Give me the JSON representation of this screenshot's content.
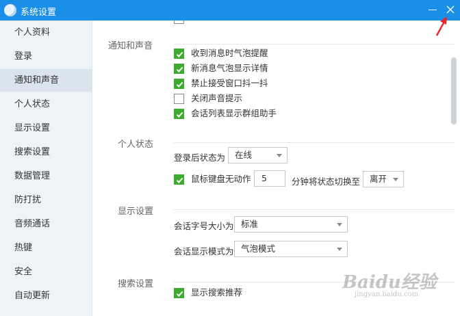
{
  "window": {
    "title": "系统设置"
  },
  "sidebar": {
    "items": [
      {
        "label": "个人资料"
      },
      {
        "label": "登录"
      },
      {
        "label": "通知和声音",
        "active": true
      },
      {
        "label": "个人状态"
      },
      {
        "label": "显示设置"
      },
      {
        "label": "搜索设置"
      },
      {
        "label": "数据管理"
      },
      {
        "label": "防打扰"
      },
      {
        "label": "音频通话"
      },
      {
        "label": "热键"
      },
      {
        "label": "安全"
      },
      {
        "label": "自动更新"
      }
    ]
  },
  "sections": {
    "notify": {
      "title": "通知和声音",
      "options": [
        {
          "label": "收到消息时气泡提醒",
          "checked": true
        },
        {
          "label": "新消息气泡显示详情",
          "checked": true
        },
        {
          "label": "禁止接受窗口抖一抖",
          "checked": true
        },
        {
          "label": "关闭声音提示",
          "checked": false
        },
        {
          "label": "会话列表显示群组助手",
          "checked": true
        }
      ]
    },
    "status": {
      "title": "个人状态",
      "login_status_label": "登录后状态为",
      "login_status_value": "在线",
      "idle_label": "鼠标键盘无动作",
      "idle_checked": true,
      "idle_minutes": "5",
      "switch_label": "分钟将状态切换至",
      "switch_value": "离开"
    },
    "display": {
      "title": "显示设置",
      "font_size_label": "会话字号大小为",
      "font_size_value": "标准",
      "mode_label": "会话显示模式为",
      "mode_value": "气泡模式"
    },
    "search": {
      "title": "搜索设置",
      "recommend_label": "显示搜索推荐",
      "recommend_checked": true
    }
  },
  "watermark": {
    "main": "Baidu经验",
    "sub": "jingyan.baidu.com"
  },
  "colors": {
    "titlebar": "#1a8fe8",
    "check": "#3cab30",
    "annotation_arrow": "#e8262a"
  }
}
